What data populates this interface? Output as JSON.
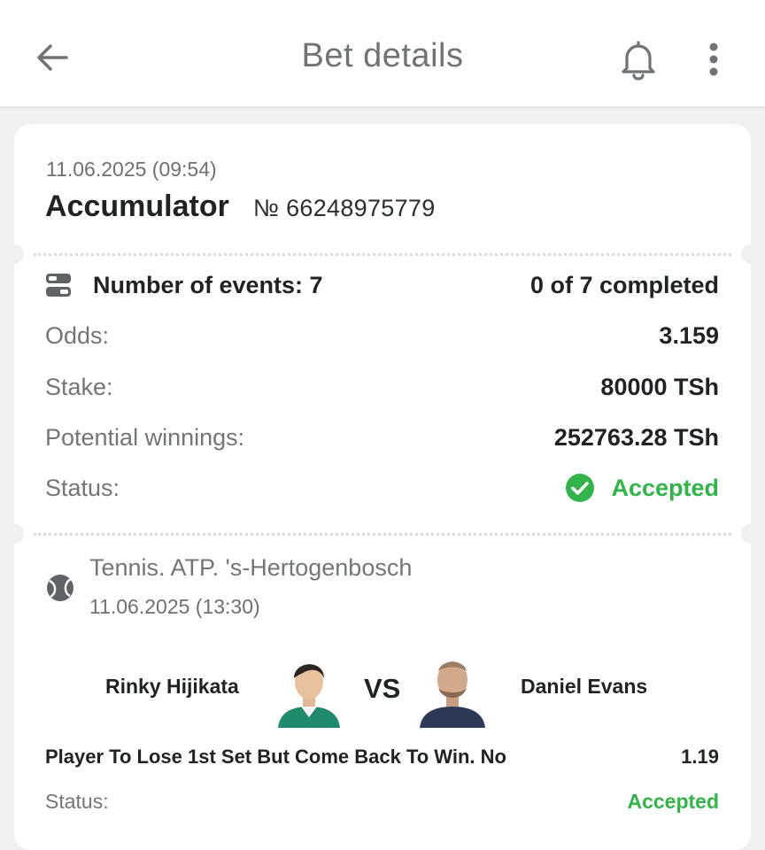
{
  "header": {
    "title": "Bet details",
    "back_icon": "arrow-left-icon",
    "notification_icon": "bell-icon",
    "menu_icon": "more-vertical-icon"
  },
  "bet": {
    "datetime": "11.06.2025 (09:54)",
    "type": "Accumulator",
    "number": "№ 66248975779",
    "events_label": "Number of events: 7",
    "completed": "0 of 7 completed",
    "odds_label": "Odds:",
    "odds_value": "3.159",
    "stake_label": "Stake:",
    "stake_value": "80000 TSh",
    "winnings_label": "Potential winnings:",
    "winnings_value": "252763.28 TSh",
    "status_label": "Status:",
    "status_value": "Accepted",
    "status_color": "#33b34a"
  },
  "event": {
    "league": "Tennis. ATP. 's-Hertogenbosch",
    "datetime": "11.06.2025 (13:30)",
    "player1": "Rinky Hijikata",
    "vs": "VS",
    "player2": "Daniel Evans",
    "selection": "Player To Lose 1st Set But Come Back To Win. No",
    "selection_odds": "1.19",
    "status_label": "Status:",
    "status_value": "Accepted"
  }
}
